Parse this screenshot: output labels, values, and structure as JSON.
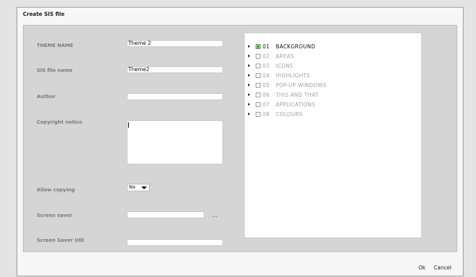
{
  "dialog": {
    "title": "Create SIS file"
  },
  "form": {
    "theme_name": {
      "label": "THEME NAME",
      "value": "Theme 2"
    },
    "sis_file_name": {
      "label": "SIS file name",
      "value": "Theme2"
    },
    "author": {
      "label": "Author",
      "value": ""
    },
    "copyright": {
      "label": "Copyright notice",
      "value": ""
    },
    "allow_copying": {
      "label": "Allow copying",
      "value": "No"
    },
    "screen_saver": {
      "label": "Screen saver",
      "value": "",
      "browse_label": "..."
    },
    "screen_saver_uid": {
      "label": "Screen Saver UID",
      "value": ""
    }
  },
  "tree": {
    "items": [
      {
        "num": "01",
        "name": "BACKGROUND",
        "checked": true
      },
      {
        "num": "02",
        "name": "AREAS",
        "checked": false
      },
      {
        "num": "03",
        "name": "ICONS",
        "checked": false
      },
      {
        "num": "04",
        "name": "HIGHLIGHTS",
        "checked": false
      },
      {
        "num": "05",
        "name": "POP-UP WINDOWS",
        "checked": false
      },
      {
        "num": "06",
        "name": "THIS AND THAT",
        "checked": false
      },
      {
        "num": "07",
        "name": "APPLICATIONS",
        "checked": false
      },
      {
        "num": "08",
        "name": "COLOURS",
        "checked": false
      }
    ]
  },
  "buttons": {
    "ok": "Ok",
    "cancel": "Cancel"
  },
  "colors": {
    "background": "#e4e4e4",
    "panel": "#d5d5d5",
    "check_green": "#2e8b2e"
  }
}
